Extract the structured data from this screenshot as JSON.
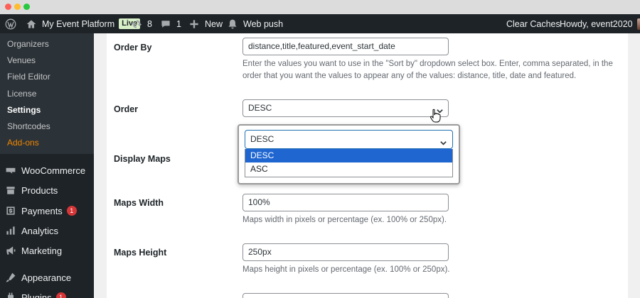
{
  "window": {
    "controls": [
      "close",
      "minimize",
      "maximize"
    ]
  },
  "admin_bar": {
    "wp_logo_icon": "wordpress-icon",
    "site_name": "My Event Platform",
    "live_badge": "Live",
    "updates_count": "8",
    "comments_count": "1",
    "new_label": "New",
    "web_push_label": "Web push",
    "clear_caches_label": "Clear Caches",
    "howdy_label": "Howdy, event2020"
  },
  "sidebar": {
    "submenu": [
      {
        "label": "Organizers"
      },
      {
        "label": "Venues"
      },
      {
        "label": "Field Editor"
      },
      {
        "label": "License"
      },
      {
        "label": "Settings"
      },
      {
        "label": "Shortcodes"
      },
      {
        "label": "Add-ons"
      }
    ],
    "menu": [
      {
        "label": "WooCommerce",
        "icon": "woocommerce-icon"
      },
      {
        "label": "Products",
        "icon": "products-icon"
      },
      {
        "label": "Payments",
        "icon": "payments-icon",
        "badge": "1"
      },
      {
        "label": "Analytics",
        "icon": "analytics-icon"
      },
      {
        "label": "Marketing",
        "icon": "marketing-icon"
      },
      {
        "label": "Appearance",
        "icon": "appearance-icon"
      },
      {
        "label": "Plugins",
        "icon": "plugins-icon",
        "badge": "1"
      }
    ]
  },
  "settings": {
    "order_by": {
      "label": "Order By",
      "value": "distance,title,featured,event_start_date",
      "description": "Enter the values you want to use in the \"Sort by\" dropdown select box. Enter, comma separated, in the order that you want the values to appear any of the values: distance, title, date and featured."
    },
    "order": {
      "label": "Order",
      "value": "DESC",
      "options": [
        "DESC",
        "ASC"
      ]
    },
    "display_maps": {
      "label": "Display Maps"
    },
    "maps_width": {
      "label": "Maps Width",
      "value": "100%",
      "description": "Maps width in pixels or percentage (ex. 100% or 250px)."
    },
    "maps_height": {
      "label": "Maps Height",
      "value": "250px",
      "description": "Maps height in pixels or percentage (ex. 100% or 250px)."
    }
  },
  "colors": {
    "admin_bar_bg": "#1d2327",
    "sidebar_bg": "#1d2327",
    "submenu_bg": "#2c3338",
    "addons_accent": "#f18500",
    "selected_option_bg": "#1f66d1",
    "badge_red": "#d63638"
  }
}
